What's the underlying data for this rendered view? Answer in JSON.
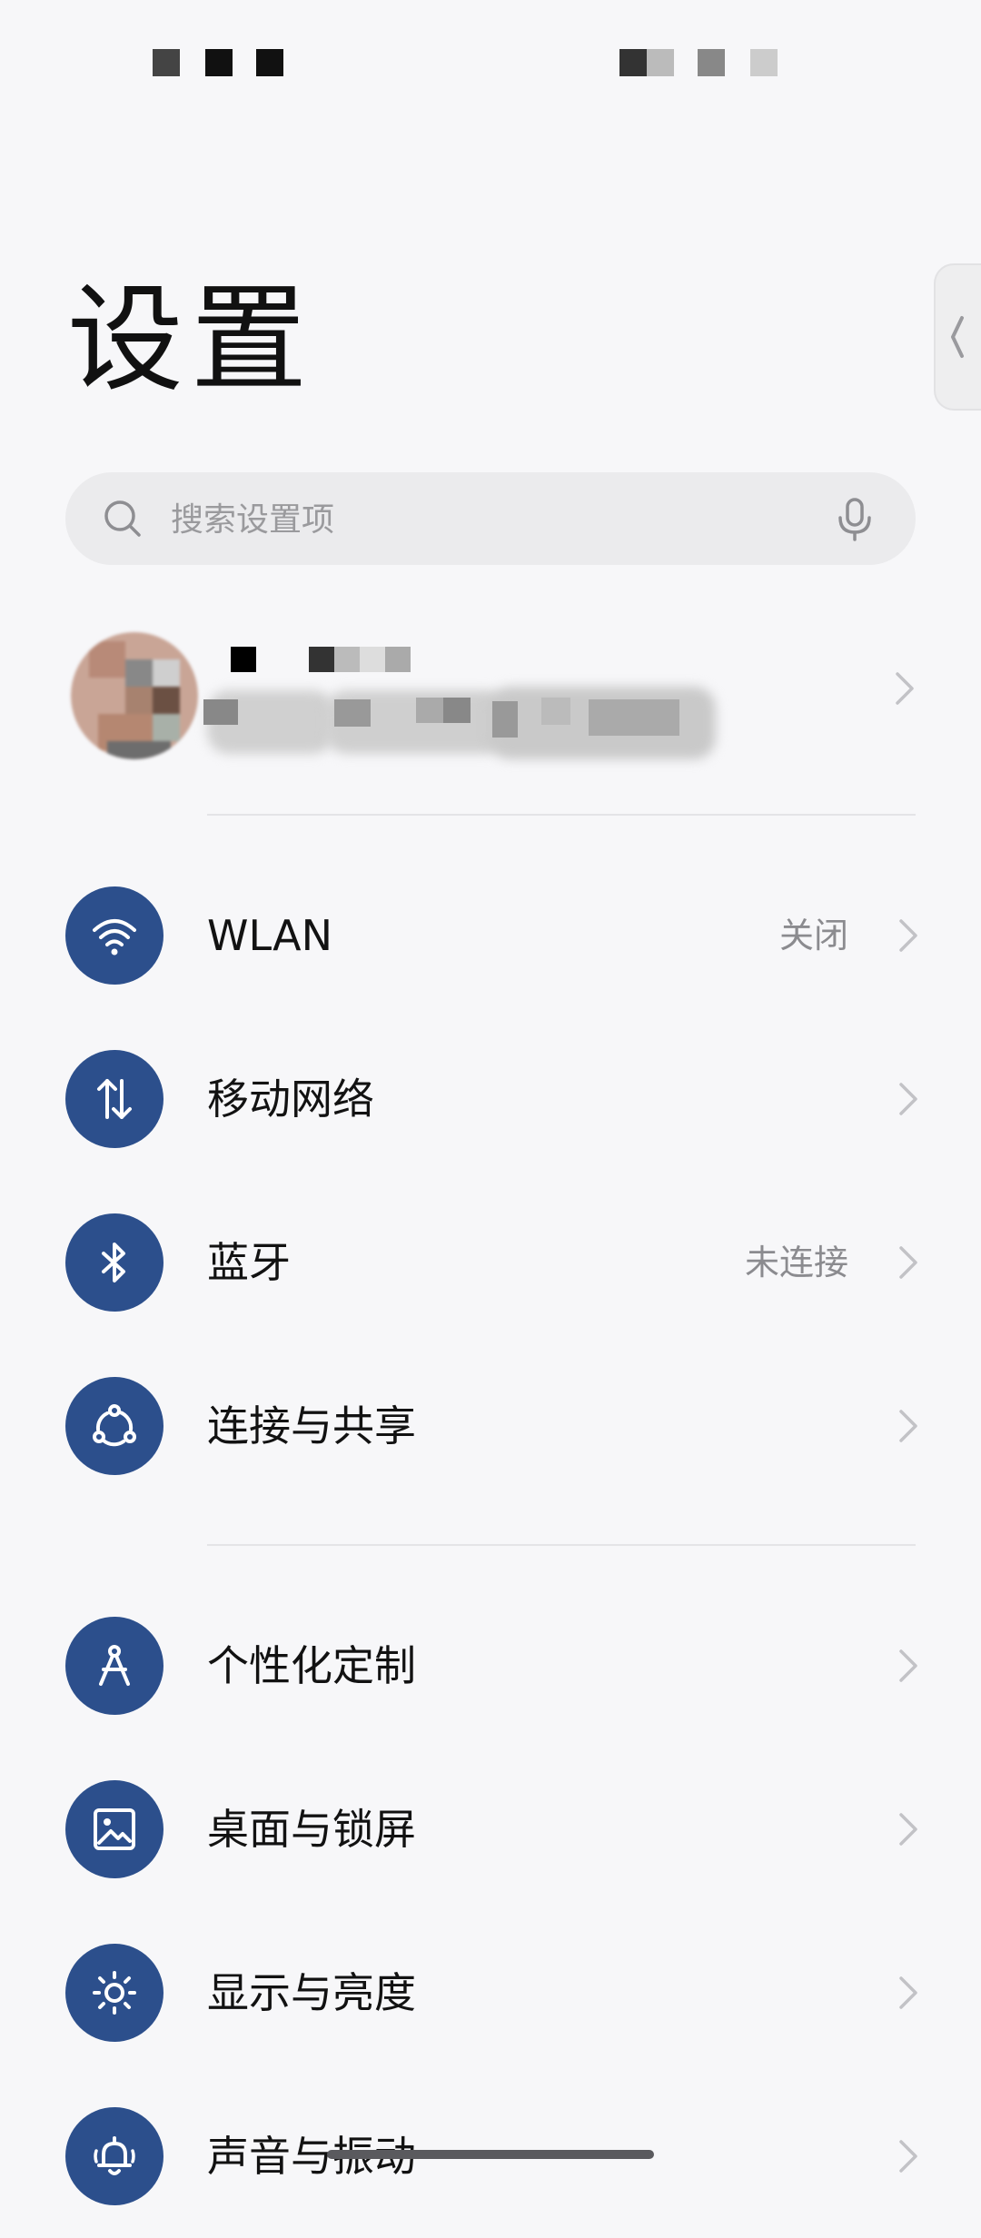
{
  "title": "设置",
  "search": {
    "placeholder": "搜索设置项"
  },
  "accent_color": "#2c4f8c",
  "groups": [
    {
      "items": [
        {
          "id": "wlan",
          "label": "WLAN",
          "value": "关闭",
          "icon": "wifi-icon"
        },
        {
          "id": "mobile-network",
          "label": "移动网络",
          "value": "",
          "icon": "mobile-data-icon"
        },
        {
          "id": "bluetooth",
          "label": "蓝牙",
          "value": "未连接",
          "icon": "bluetooth-icon"
        },
        {
          "id": "connection-sharing",
          "label": "连接与共享",
          "value": "",
          "icon": "connection-sharing-icon"
        }
      ]
    },
    {
      "items": [
        {
          "id": "personalization",
          "label": "个性化定制",
          "value": "",
          "icon": "compass-icon"
        },
        {
          "id": "desktop-lockscreen",
          "label": "桌面与锁屏",
          "value": "",
          "icon": "image-icon"
        },
        {
          "id": "display-brightness",
          "label": "显示与亮度",
          "value": "",
          "icon": "sun-icon"
        },
        {
          "id": "sound-vibration",
          "label": "声音与振动",
          "value": "",
          "icon": "bell-icon"
        }
      ]
    }
  ]
}
